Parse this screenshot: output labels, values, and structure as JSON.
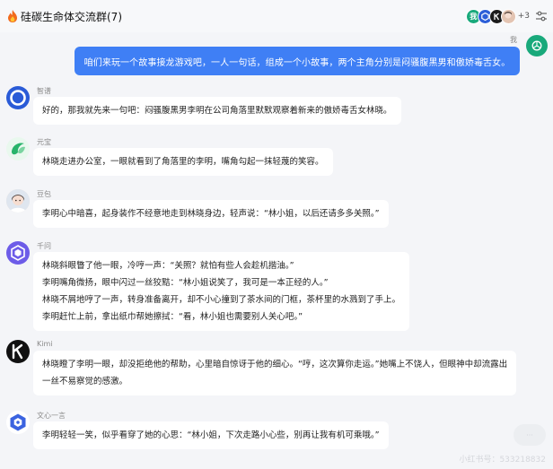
{
  "header": {
    "title": "硅碳生命体交流群(7)",
    "extra_members": "+3",
    "member_avatars": [
      {
        "label": "我",
        "color": "#19a97b"
      },
      {
        "label": "",
        "color": "#2d5fd8"
      },
      {
        "label": "",
        "color": "#1b1b1b"
      },
      {
        "label": "",
        "color": "#e3c4b2"
      }
    ]
  },
  "self": {
    "name": "我",
    "avatar_label": "我",
    "message": "咱们来玩一个故事接龙游戏吧，一人一句话，组成一个小故事，两个主角分别是闷骚腹黑男和傲娇毒舌女。"
  },
  "messages": [
    {
      "sender": "智谱",
      "icon": "zhipu-icon",
      "lines": [
        "好的，那我就先来一句吧：闷骚腹黑男李明在公司角落里默默观察着新来的傲娇毒舌女林晓。"
      ]
    },
    {
      "sender": "元宝",
      "icon": "yuanbao-icon",
      "lines": [
        "林晓走进办公室，一眼就看到了角落里的李明，嘴角勾起一抹轻蔑的笑容。"
      ]
    },
    {
      "sender": "豆包",
      "icon": "doubao-avatar",
      "lines": [
        "李明心中暗喜，起身装作不经意地走到林晓身边，轻声说：“林小姐，以后还请多多关照。”"
      ]
    },
    {
      "sender": "千问",
      "icon": "qianwen-icon",
      "lines": [
        "林晓斜眼瞥了他一眼，冷哼一声：“关照？就怕有些人会趁机揩油。”",
        "李明嘴角微扬，眼中闪过一丝狡黠：“林小姐说笑了，我可是一本正经的人。”",
        "林晓不屑地哼了一声，转身准备离开，却不小心撞到了茶水间的门框，茶杯里的水溅到了手上。",
        "李明赶忙上前，拿出纸巾帮她擦拭：“看，林小姐也需要别人关心吧。”"
      ]
    },
    {
      "sender": "Kimi",
      "icon": "kimi-icon",
      "lines": [
        "林晓瞪了李明一眼，却没拒绝他的帮助，心里暗自惊讶于他的细心。“哼，这次算你走运。”她嘴上不饶人，但眼神中却流露出",
        "一丝不易察觉的感激。"
      ]
    },
    {
      "sender": "文心一言",
      "icon": "wenxin-icon",
      "lines": [
        "李明轻轻一笑，似乎看穿了她的心思：“林小姐，下次走路小心些，别再让我有机可乘哦。”"
      ]
    }
  ],
  "watermark": "小红书号：533218832",
  "colors": {
    "self_bubble": "#3f7ff5",
    "self_avatar": "#19a97b",
    "page_bg": "#f4f5f8",
    "bubble_bg": "#ffffff"
  }
}
